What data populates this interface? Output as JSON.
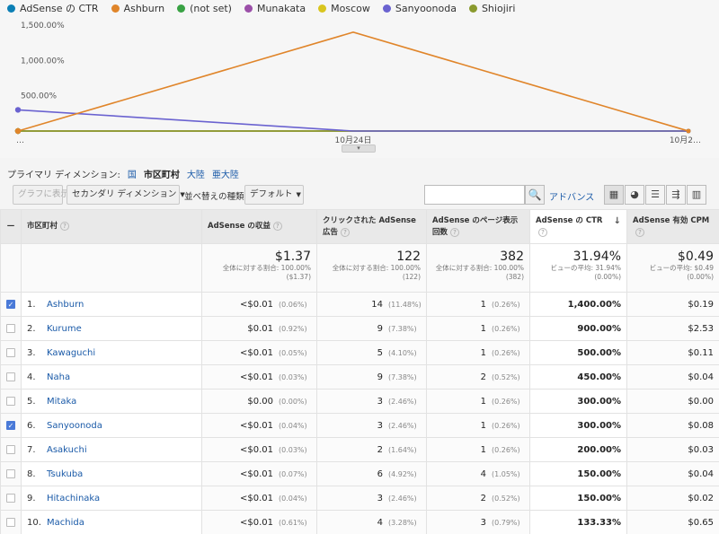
{
  "legend": [
    {
      "name": "AdSense の CTR",
      "color": "#0b7fb5"
    },
    {
      "name": "Ashburn",
      "color": "#e0852a"
    },
    {
      "name": "(not set)",
      "color": "#39a244"
    },
    {
      "name": "Munakata",
      "color": "#9b4fa8"
    },
    {
      "name": "Moscow",
      "color": "#d9c51e"
    },
    {
      "name": "Sanyoonoda",
      "color": "#6a62d0"
    },
    {
      "name": "Shiojiri",
      "color": "#8a9a2e"
    }
  ],
  "chart_data": {
    "type": "line",
    "x": [
      "…",
      "10月24日",
      "10月2…"
    ],
    "y_tick_labels": [
      "500.00%",
      "1,000.00%",
      "1,500.00%"
    ],
    "ylim": [
      0,
      1500
    ],
    "grid": false,
    "legend_placement": "top",
    "series": [
      {
        "name": "AdSense の CTR",
        "values": [
          0,
          0,
          0
        ]
      },
      {
        "name": "Ashburn",
        "values": [
          0,
          1400,
          0
        ]
      },
      {
        "name": "(not set)",
        "values": [
          0,
          0,
          0
        ]
      },
      {
        "name": "Munakata",
        "values": [
          0,
          0,
          0
        ]
      },
      {
        "name": "Moscow",
        "values": [
          0,
          0,
          0
        ]
      },
      {
        "name": "Sanyoonoda",
        "values": [
          300,
          0,
          0
        ]
      },
      {
        "name": "Shiojiri",
        "values": [
          0,
          0,
          0
        ]
      }
    ]
  },
  "chart_handle": "▾",
  "primary_dimension": {
    "label": "プライマリ ディメンション:",
    "options": [
      {
        "label": "国",
        "active": false
      },
      {
        "label": "市区町村",
        "active": true
      },
      {
        "label": "大陸",
        "active": false
      },
      {
        "label": "亜大陸",
        "active": false
      }
    ]
  },
  "toolbar": {
    "graph_label": "グラフに表示",
    "secondary_dimension_label": "セカンダリ ディメンション",
    "sort_label": "並べ替えの種類:",
    "sort_value": "デフォルト",
    "search_placeholder": "",
    "search_icon": "🔍",
    "advanced_label": "アドバンス",
    "view_icons": [
      "grid-view-icon",
      "pie-view-icon",
      "bar-view-icon",
      "compare-view-icon",
      "pivot-view-icon"
    ],
    "view_glyphs": [
      "▦",
      "◕",
      "☰",
      "⇶",
      "▥"
    ]
  },
  "table": {
    "select_all_glyph": "—",
    "headers": [
      "市区町村",
      "AdSense の収益",
      "クリックされた AdSense 広告",
      "AdSense のページ表示回数",
      "AdSense の CTR",
      "AdSense 有効 CPM"
    ],
    "help_glyph": "?",
    "sort_glyph": "↓",
    "totals": [
      {
        "value": "$1.37",
        "sub": "全体に対する割合: 100.00% ($1.37)"
      },
      {
        "value": "122",
        "sub": "全体に対する割合: 100.00% (122)"
      },
      {
        "value": "382",
        "sub": "全体に対する割合: 100.00% (382)"
      },
      {
        "value": "31.94%",
        "sub": "ビューの平均: 31.94% (0.00%)"
      },
      {
        "value": "$0.49",
        "sub": "ビューの平均: $0.49 (0.00%)"
      }
    ],
    "rows": [
      {
        "checked": true,
        "idx": "1.",
        "city": "Ashburn",
        "revenue": "<$0.01",
        "revenue_pct": "(0.06%)",
        "clicks": "14",
        "clicks_pct": "(11.48%)",
        "views": "1",
        "views_pct": "(0.26%)",
        "ctr": "1,400.00%",
        "cpm": "$0.19"
      },
      {
        "checked": false,
        "idx": "2.",
        "city": "Kurume",
        "revenue": "$0.01",
        "revenue_pct": "(0.92%)",
        "clicks": "9",
        "clicks_pct": "(7.38%)",
        "views": "1",
        "views_pct": "(0.26%)",
        "ctr": "900.00%",
        "cpm": "$2.53"
      },
      {
        "checked": false,
        "idx": "3.",
        "city": "Kawaguchi",
        "revenue": "<$0.01",
        "revenue_pct": "(0.05%)",
        "clicks": "5",
        "clicks_pct": "(4.10%)",
        "views": "1",
        "views_pct": "(0.26%)",
        "ctr": "500.00%",
        "cpm": "$0.11"
      },
      {
        "checked": false,
        "idx": "4.",
        "city": "Naha",
        "revenue": "<$0.01",
        "revenue_pct": "(0.03%)",
        "clicks": "9",
        "clicks_pct": "(7.38%)",
        "views": "2",
        "views_pct": "(0.52%)",
        "ctr": "450.00%",
        "cpm": "$0.04"
      },
      {
        "checked": false,
        "idx": "5.",
        "city": "Mitaka",
        "revenue": "$0.00",
        "revenue_pct": "(0.00%)",
        "clicks": "3",
        "clicks_pct": "(2.46%)",
        "views": "1",
        "views_pct": "(0.26%)",
        "ctr": "300.00%",
        "cpm": "$0.00"
      },
      {
        "checked": true,
        "idx": "6.",
        "city": "Sanyoonoda",
        "revenue": "<$0.01",
        "revenue_pct": "(0.04%)",
        "clicks": "3",
        "clicks_pct": "(2.46%)",
        "views": "1",
        "views_pct": "(0.26%)",
        "ctr": "300.00%",
        "cpm": "$0.08"
      },
      {
        "checked": false,
        "idx": "7.",
        "city": "Asakuchi",
        "revenue": "<$0.01",
        "revenue_pct": "(0.03%)",
        "clicks": "2",
        "clicks_pct": "(1.64%)",
        "views": "1",
        "views_pct": "(0.26%)",
        "ctr": "200.00%",
        "cpm": "$0.03"
      },
      {
        "checked": false,
        "idx": "8.",
        "city": "Tsukuba",
        "revenue": "<$0.01",
        "revenue_pct": "(0.07%)",
        "clicks": "6",
        "clicks_pct": "(4.92%)",
        "views": "4",
        "views_pct": "(1.05%)",
        "ctr": "150.00%",
        "cpm": "$0.04"
      },
      {
        "checked": false,
        "idx": "9.",
        "city": "Hitachinaka",
        "revenue": "<$0.01",
        "revenue_pct": "(0.04%)",
        "clicks": "3",
        "clicks_pct": "(2.46%)",
        "views": "2",
        "views_pct": "(0.52%)",
        "ctr": "150.00%",
        "cpm": "$0.02"
      },
      {
        "checked": false,
        "idx": "10.",
        "city": "Machida",
        "revenue": "<$0.01",
        "revenue_pct": "(0.61%)",
        "clicks": "4",
        "clicks_pct": "(3.28%)",
        "views": "3",
        "views_pct": "(0.79%)",
        "ctr": "133.33%",
        "cpm": "$0.65"
      }
    ]
  }
}
